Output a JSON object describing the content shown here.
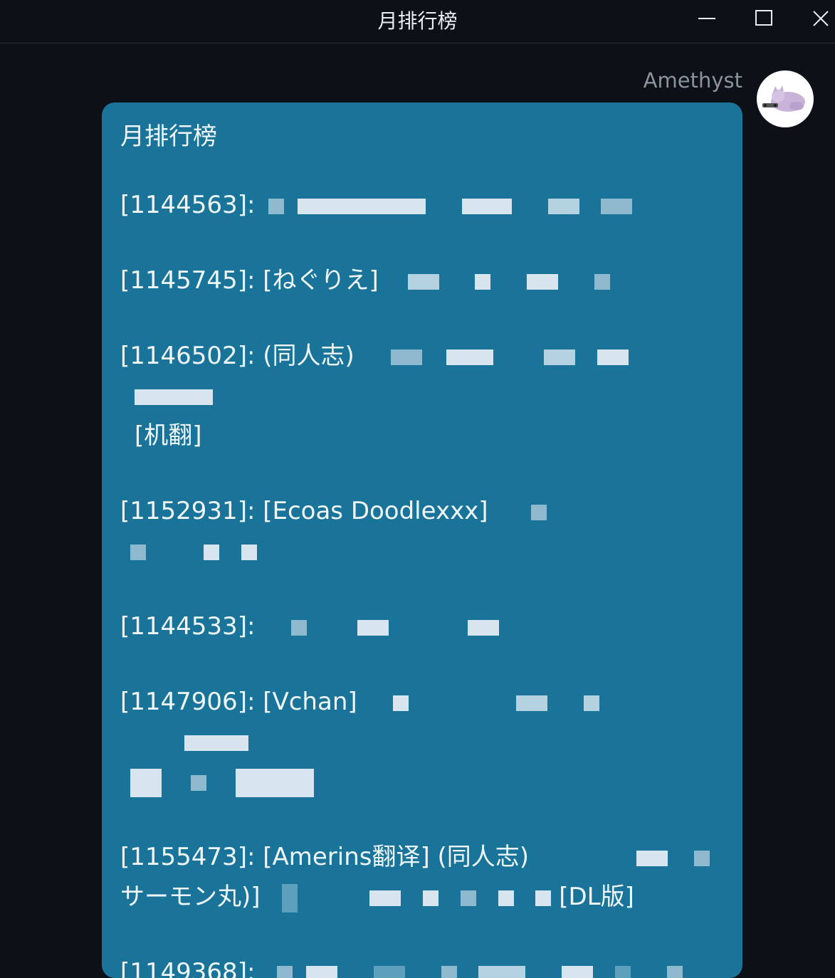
{
  "window": {
    "title": "月排行榜"
  },
  "message": {
    "sender": "Amethyst",
    "title": "月排行榜",
    "entries": [
      {
        "line1": "[1144563]:",
        "line2": ""
      },
      {
        "line1": "[1145745]: [ねぐりえ]",
        "line2": ""
      },
      {
        "line1": "[1146502]: (同人志)",
        "line2": "[机翻]"
      },
      {
        "line1": "[1152931]: [Ecoas Doodlexxx]",
        "line2": ""
      },
      {
        "line1": "[1144533]:",
        "line2": ""
      },
      {
        "line1": "[1147906]: [Vchan]",
        "line2": ""
      },
      {
        "line1": "[1155473]: [Amerins翻译] (同人志)",
        "line2": "サーモン丸)]",
        "line2_tail": "[DL版]"
      },
      {
        "line1": "[1149368]:",
        "line2": ""
      }
    ]
  },
  "icons": {
    "minimize": "minimize-icon",
    "maximize": "maximize-icon",
    "close": "close-icon",
    "avatar": "cat-avatar-icon"
  }
}
